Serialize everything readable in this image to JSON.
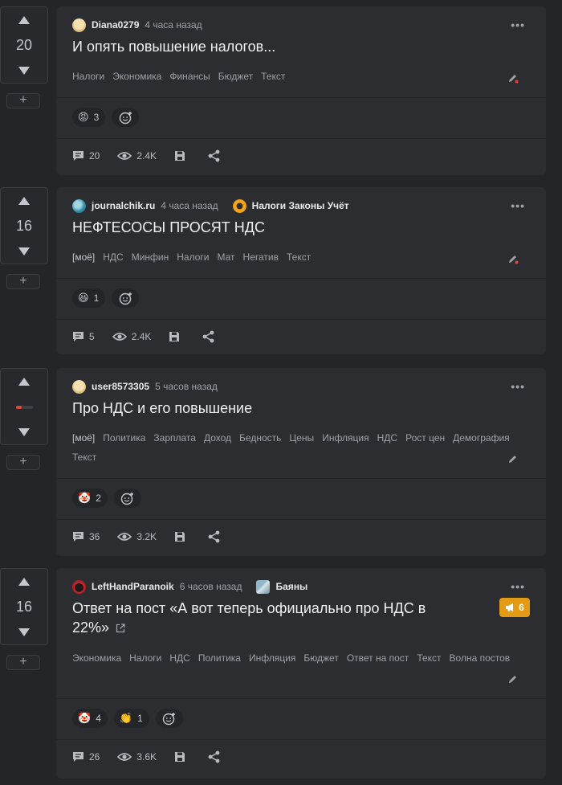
{
  "posts": [
    {
      "rating": "20",
      "author": "Diana0279",
      "time": "4 часа назад",
      "title": "И опять повышение налогов...",
      "tags": [
        "Налоги",
        "Экономика",
        "Финансы",
        "Бюджет",
        "Текст"
      ],
      "reactions": [
        {
          "emoji": "😡",
          "count": "3"
        }
      ],
      "comments": "20",
      "views": "2.4K"
    },
    {
      "rating": "16",
      "author": "journalchik.ru",
      "time": "4 часа назад",
      "community": "Налоги Законы Учёт",
      "title": "НЕФТЕСОСЫ ПРОСЯТ НДС",
      "own_tag": "[моё]",
      "tags": [
        "НДС",
        "Минфин",
        "Налоги",
        "Мат",
        "Негатив",
        "Текст"
      ],
      "reactions": [
        {
          "emoji": "😆",
          "count": "1"
        }
      ],
      "comments": "5",
      "views": "2.4K"
    },
    {
      "author": "user8573305",
      "time": "5 часов назад",
      "title": "Про НДС и его повышение",
      "own_tag": "[моё]",
      "tags": [
        "Политика",
        "Зарплата",
        "Доход",
        "Бедность",
        "Цены",
        "Инфляция",
        "НДС",
        "Рост цен",
        "Демография"
      ],
      "tags_line2": [
        "Текст"
      ],
      "reactions": [
        {
          "emoji": "🤡",
          "count": "2"
        }
      ],
      "comments": "36",
      "views": "3.2K"
    },
    {
      "rating": "16",
      "author": "LeftHandParanoik",
      "time": "6 часов назад",
      "community": "Баяны",
      "title_line1": "Ответ на пост «А вот теперь официально про НДС в",
      "title_line2": "22%»",
      "badge": "6",
      "tags": [
        "Экономика",
        "Налоги",
        "НДС",
        "Политика",
        "Инфляция",
        "Бюджет",
        "Ответ на пост",
        "Текст",
        "Волна постов"
      ],
      "reactions": [
        {
          "emoji": "🤡",
          "count": "4"
        },
        {
          "emoji": "👏",
          "count": "1"
        }
      ],
      "comments": "26",
      "views": "3.6K"
    }
  ],
  "ui": {
    "plus": "+",
    "dots": "•••"
  },
  "colors": {
    "accent_badge": "#e39a14",
    "downvote_mark": "#e0453b"
  }
}
